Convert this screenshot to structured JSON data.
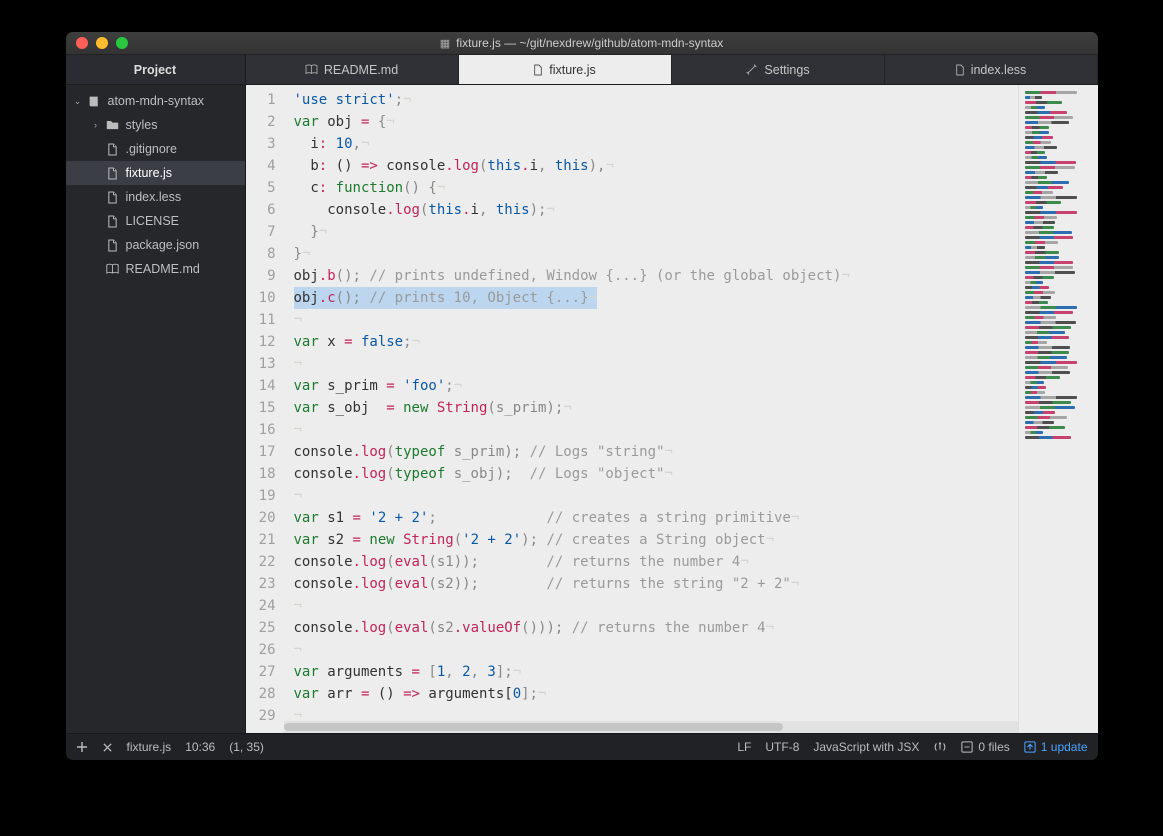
{
  "window": {
    "title": "fixture.js — ~/git/nexdrew/github/atom-mdn-syntax"
  },
  "sidebar": {
    "header": "Project",
    "root": {
      "label": "atom-mdn-syntax",
      "expanded": true
    },
    "items": [
      {
        "label": "styles",
        "type": "folder",
        "indent": 1
      },
      {
        "label": ".gitignore",
        "type": "file",
        "indent": 1
      },
      {
        "label": "fixture.js",
        "type": "file",
        "indent": 1,
        "selected": true
      },
      {
        "label": "index.less",
        "type": "file",
        "indent": 1
      },
      {
        "label": "LICENSE",
        "type": "file",
        "indent": 1
      },
      {
        "label": "package.json",
        "type": "file",
        "indent": 1
      },
      {
        "label": "README.md",
        "type": "book",
        "indent": 1
      }
    ]
  },
  "tabs": [
    {
      "label": "README.md",
      "icon": "book"
    },
    {
      "label": "fixture.js",
      "icon": "file",
      "active": true
    },
    {
      "label": "Settings",
      "icon": "tools"
    },
    {
      "label": "index.less",
      "icon": "file"
    }
  ],
  "editor": {
    "highlight_line": 10,
    "lines": [
      [
        {
          "t": "'use strict'",
          "c": "s"
        },
        {
          "t": ";",
          "c": "p"
        }
      ],
      [
        {
          "t": "var",
          "c": "k"
        },
        {
          "t": " obj ",
          "c": "id"
        },
        {
          "t": "=",
          "c": "op"
        },
        {
          "t": " {",
          "c": "p"
        }
      ],
      [
        {
          "t": "  ",
          "c": "id"
        },
        {
          "t": "i",
          "c": "id"
        },
        {
          "t": ":",
          "c": "op"
        },
        {
          "t": " ",
          "c": "id"
        },
        {
          "t": "10",
          "c": "n"
        },
        {
          "t": ",",
          "c": "p"
        }
      ],
      [
        {
          "t": "  ",
          "c": "id"
        },
        {
          "t": "b",
          "c": "id"
        },
        {
          "t": ":",
          "c": "op"
        },
        {
          "t": " () ",
          "c": "id"
        },
        {
          "t": "=>",
          "c": "op"
        },
        {
          "t": " console",
          "c": "id"
        },
        {
          "t": ".",
          "c": "op"
        },
        {
          "t": "log",
          "c": "fn"
        },
        {
          "t": "(",
          "c": "p"
        },
        {
          "t": "this",
          "c": "b"
        },
        {
          "t": ".",
          "c": "op"
        },
        {
          "t": "i",
          "c": "id"
        },
        {
          "t": ", ",
          "c": "p"
        },
        {
          "t": "this",
          "c": "b"
        },
        {
          "t": "),",
          "c": "p"
        }
      ],
      [
        {
          "t": "  ",
          "c": "id"
        },
        {
          "t": "c",
          "c": "id"
        },
        {
          "t": ":",
          "c": "op"
        },
        {
          "t": " ",
          "c": "id"
        },
        {
          "t": "function",
          "c": "k"
        },
        {
          "t": "() {",
          "c": "p"
        }
      ],
      [
        {
          "t": "    console",
          "c": "id"
        },
        {
          "t": ".",
          "c": "op"
        },
        {
          "t": "log",
          "c": "fn"
        },
        {
          "t": "(",
          "c": "p"
        },
        {
          "t": "this",
          "c": "b"
        },
        {
          "t": ".",
          "c": "op"
        },
        {
          "t": "i",
          "c": "id"
        },
        {
          "t": ", ",
          "c": "p"
        },
        {
          "t": "this",
          "c": "b"
        },
        {
          "t": ");",
          "c": "p"
        }
      ],
      [
        {
          "t": "  }",
          "c": "p"
        }
      ],
      [
        {
          "t": "}",
          "c": "p"
        }
      ],
      [
        {
          "t": "obj",
          "c": "id"
        },
        {
          "t": ".",
          "c": "op"
        },
        {
          "t": "b",
          "c": "fn"
        },
        {
          "t": "(); ",
          "c": "p"
        },
        {
          "t": "// prints undefined, Window {...} (or the global object)",
          "c": "cm"
        }
      ],
      [
        {
          "t": "obj",
          "c": "id"
        },
        {
          "t": ".",
          "c": "op"
        },
        {
          "t": "c",
          "c": "fn"
        },
        {
          "t": "(); ",
          "c": "p"
        },
        {
          "t": "// prints 10, Object {...}",
          "c": "cm"
        }
      ],
      [],
      [
        {
          "t": "var",
          "c": "k"
        },
        {
          "t": " x ",
          "c": "id"
        },
        {
          "t": "=",
          "c": "op"
        },
        {
          "t": " ",
          "c": "id"
        },
        {
          "t": "false",
          "c": "b"
        },
        {
          "t": ";",
          "c": "p"
        }
      ],
      [],
      [
        {
          "t": "var",
          "c": "k"
        },
        {
          "t": " s_prim ",
          "c": "id"
        },
        {
          "t": "=",
          "c": "op"
        },
        {
          "t": " ",
          "c": "id"
        },
        {
          "t": "'foo'",
          "c": "s"
        },
        {
          "t": ";",
          "c": "p"
        }
      ],
      [
        {
          "t": "var",
          "c": "k"
        },
        {
          "t": " s_obj  ",
          "c": "id"
        },
        {
          "t": "=",
          "c": "op"
        },
        {
          "t": " ",
          "c": "id"
        },
        {
          "t": "new",
          "c": "k"
        },
        {
          "t": " ",
          "c": "id"
        },
        {
          "t": "String",
          "c": "fn"
        },
        {
          "t": "(s_prim);",
          "c": "p"
        }
      ],
      [],
      [
        {
          "t": "console",
          "c": "id"
        },
        {
          "t": ".",
          "c": "op"
        },
        {
          "t": "log",
          "c": "fn"
        },
        {
          "t": "(",
          "c": "p"
        },
        {
          "t": "typeof",
          "c": "k"
        },
        {
          "t": " s_prim); ",
          "c": "p"
        },
        {
          "t": "// Logs \"string\"",
          "c": "cm"
        }
      ],
      [
        {
          "t": "console",
          "c": "id"
        },
        {
          "t": ".",
          "c": "op"
        },
        {
          "t": "log",
          "c": "fn"
        },
        {
          "t": "(",
          "c": "p"
        },
        {
          "t": "typeof",
          "c": "k"
        },
        {
          "t": " s_obj);  ",
          "c": "p"
        },
        {
          "t": "// Logs \"object\"",
          "c": "cm"
        }
      ],
      [],
      [
        {
          "t": "var",
          "c": "k"
        },
        {
          "t": " s1 ",
          "c": "id"
        },
        {
          "t": "=",
          "c": "op"
        },
        {
          "t": " ",
          "c": "id"
        },
        {
          "t": "'2 + 2'",
          "c": "s"
        },
        {
          "t": ";             ",
          "c": "p"
        },
        {
          "t": "// creates a string primitive",
          "c": "cm"
        }
      ],
      [
        {
          "t": "var",
          "c": "k"
        },
        {
          "t": " s2 ",
          "c": "id"
        },
        {
          "t": "=",
          "c": "op"
        },
        {
          "t": " ",
          "c": "id"
        },
        {
          "t": "new",
          "c": "k"
        },
        {
          "t": " ",
          "c": "id"
        },
        {
          "t": "String",
          "c": "fn"
        },
        {
          "t": "(",
          "c": "p"
        },
        {
          "t": "'2 + 2'",
          "c": "s"
        },
        {
          "t": "); ",
          "c": "p"
        },
        {
          "t": "// creates a String object",
          "c": "cm"
        }
      ],
      [
        {
          "t": "console",
          "c": "id"
        },
        {
          "t": ".",
          "c": "op"
        },
        {
          "t": "log",
          "c": "fn"
        },
        {
          "t": "(",
          "c": "p"
        },
        {
          "t": "eval",
          "c": "fn"
        },
        {
          "t": "(s1));        ",
          "c": "p"
        },
        {
          "t": "// returns the number 4",
          "c": "cm"
        }
      ],
      [
        {
          "t": "console",
          "c": "id"
        },
        {
          "t": ".",
          "c": "op"
        },
        {
          "t": "log",
          "c": "fn"
        },
        {
          "t": "(",
          "c": "p"
        },
        {
          "t": "eval",
          "c": "fn"
        },
        {
          "t": "(s2));        ",
          "c": "p"
        },
        {
          "t": "// returns the string \"2 + 2\"",
          "c": "cm"
        }
      ],
      [],
      [
        {
          "t": "console",
          "c": "id"
        },
        {
          "t": ".",
          "c": "op"
        },
        {
          "t": "log",
          "c": "fn"
        },
        {
          "t": "(",
          "c": "p"
        },
        {
          "t": "eval",
          "c": "fn"
        },
        {
          "t": "(s2",
          "c": "p"
        },
        {
          "t": ".",
          "c": "op"
        },
        {
          "t": "valueOf",
          "c": "fn"
        },
        {
          "t": "())); ",
          "c": "p"
        },
        {
          "t": "// returns the number 4",
          "c": "cm"
        }
      ],
      [],
      [
        {
          "t": "var",
          "c": "k"
        },
        {
          "t": " arguments ",
          "c": "id"
        },
        {
          "t": "=",
          "c": "op"
        },
        {
          "t": " [",
          "c": "p"
        },
        {
          "t": "1",
          "c": "n"
        },
        {
          "t": ", ",
          "c": "p"
        },
        {
          "t": "2",
          "c": "n"
        },
        {
          "t": ", ",
          "c": "p"
        },
        {
          "t": "3",
          "c": "n"
        },
        {
          "t": "];",
          "c": "p"
        }
      ],
      [
        {
          "t": "var",
          "c": "k"
        },
        {
          "t": " arr ",
          "c": "id"
        },
        {
          "t": "=",
          "c": "op"
        },
        {
          "t": " () ",
          "c": "id"
        },
        {
          "t": "=>",
          "c": "op"
        },
        {
          "t": " arguments[",
          "c": "id"
        },
        {
          "t": "0",
          "c": "n"
        },
        {
          "t": "];",
          "c": "p"
        }
      ],
      []
    ]
  },
  "status": {
    "file": "fixture.js",
    "time": "10:36",
    "position": "(1, 35)",
    "eol": "LF",
    "encoding": "UTF-8",
    "grammar": "JavaScript with JSX",
    "git_files": "0 files",
    "updates": "1 update"
  }
}
